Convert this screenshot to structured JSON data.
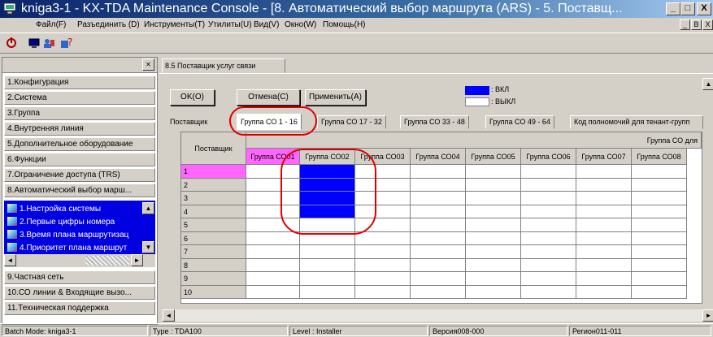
{
  "window": {
    "title": "kniga3-1 - KX-TDA Maintenance Console - [8. Автоматический выбор маршрута (ARS) - 5. Поставщ...",
    "min": "_",
    "max": "□",
    "close": "X"
  },
  "menu": [
    "Файл(F)",
    "Разъединить (D)",
    "Инструменты(T)",
    "Утилиты(U)",
    "Вид(V)",
    "Окно(W)",
    "Помощь(H)"
  ],
  "mdi_controls": [
    "_",
    "B",
    "X"
  ],
  "nav": {
    "items": [
      "1.Конфигурация",
      "2.Система",
      "3.Группа",
      "4.Внутренняя линия",
      "5.Дополнительное оборудование",
      "6.Функции",
      "7.Ограничение доступа (TRS)",
      "8.Автоматический выбор марш..."
    ],
    "sub_items": [
      "1.Настройка системы",
      "2.Первые цифры номера",
      "3.Время плана маршрутизац",
      "4.Приоритет плана маршрут"
    ],
    "bottom_items": [
      "9.Частная сеть",
      "10.СО линии & Входящие вызо...",
      "11.Техническая поддержка"
    ]
  },
  "panel": {
    "tab_title": "8.5 Поставщик услуг связи",
    "ok": "OK(O)",
    "cancel": "Отмена(C)",
    "apply": "Применить(A)",
    "legend_on": ": ВКЛ",
    "legend_off": ": ВЫКЛ",
    "tabs": [
      "Поставщик",
      "Группа СО 1 - 16",
      "Группа СО 17 - 32",
      "Группа СО 33 - 48",
      "Группа СО 49 - 64",
      "Код полномочий для тенант-групп"
    ],
    "selected_tab": "Группа СО 1 - 16",
    "grid_corner": "Поставщик",
    "group_label": "Группа СО для",
    "columns": [
      "Группа СО01",
      "Группа СО02",
      "Группа СО03",
      "Группа СО04",
      "Группа СО05",
      "Группа СО06",
      "Группа СО07",
      "Группа СО08"
    ],
    "rows": [
      "1",
      "2",
      "3",
      "4",
      "5",
      "6",
      "7",
      "8",
      "9",
      "10"
    ],
    "on_cells": [
      [
        0,
        1
      ],
      [
        1,
        1
      ],
      [
        2,
        1
      ],
      [
        3,
        1
      ]
    ]
  },
  "status": {
    "batch": "Batch Mode: kniga3-1",
    "type": "Type : TDA100",
    "level": "Level : Installer",
    "version": "Версия008-000",
    "region": "Регион011-011"
  },
  "colors": {
    "on": "#0000ff",
    "selected_row": "#ff66ff",
    "annotation": "#e00000"
  }
}
